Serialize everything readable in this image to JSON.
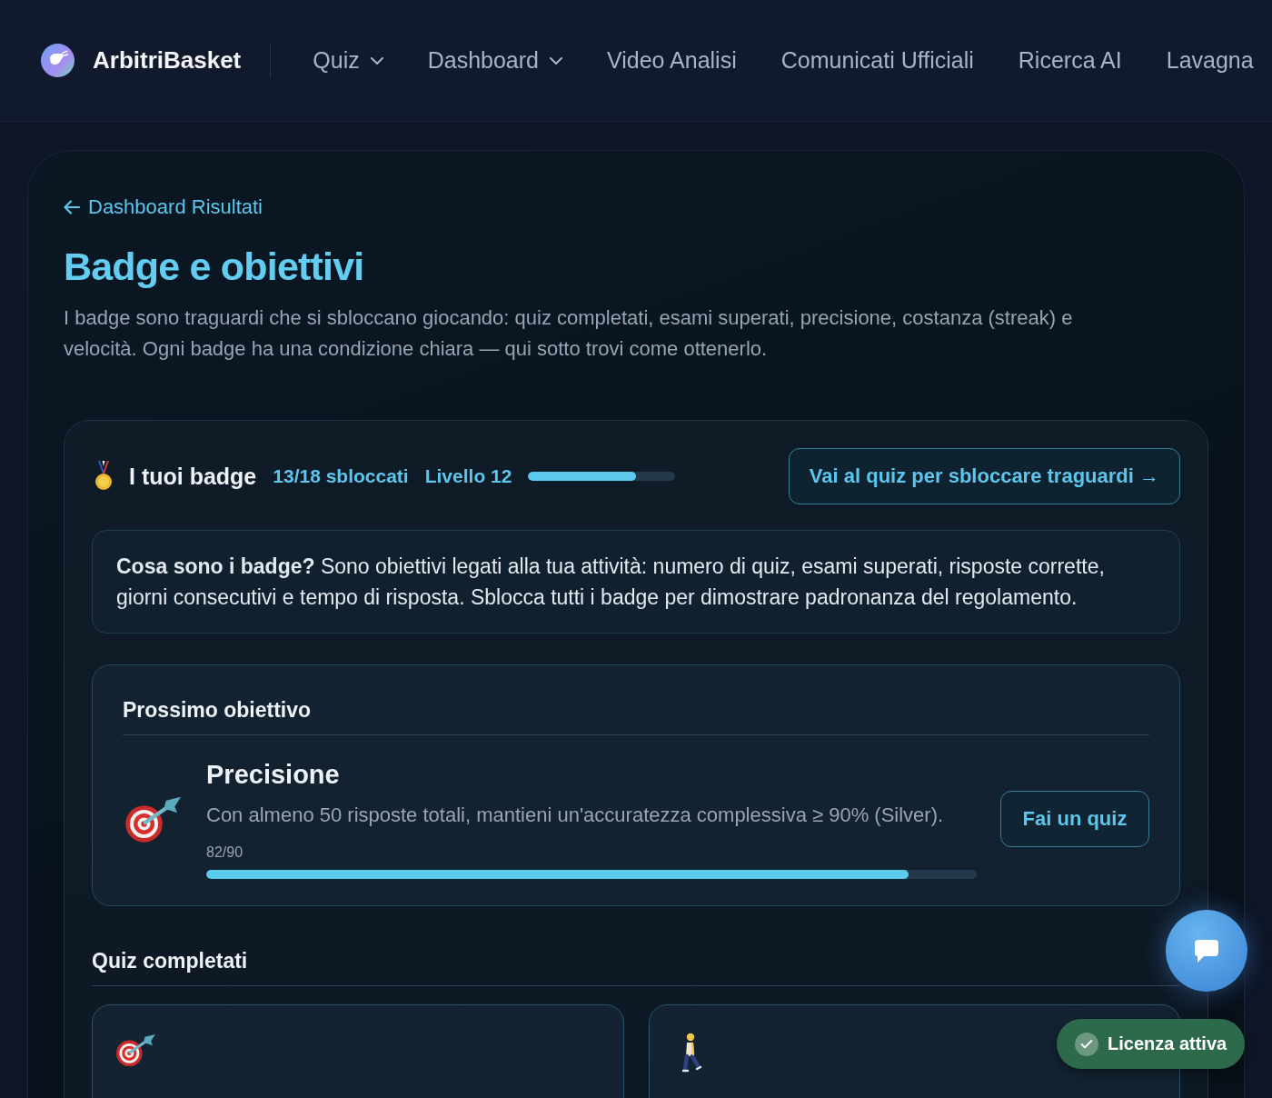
{
  "nav": {
    "brand": "ArbitriBasket",
    "items": [
      {
        "label": "Quiz",
        "has_menu": true
      },
      {
        "label": "Dashboard",
        "has_menu": true
      },
      {
        "label": "Video Analisi",
        "has_menu": false
      },
      {
        "label": "Comunicati Ufficiali",
        "has_menu": false
      },
      {
        "label": "Ricerca AI",
        "has_menu": false
      },
      {
        "label": "Lavagna",
        "has_menu": false
      }
    ]
  },
  "page": {
    "back_link": "Dashboard Risultati",
    "title": "Badge e obiettivi",
    "description": "I badge sono traguardi che si sbloccano giocando: quiz completati, esami superati, precisione, costanza (streak) e velocità. Ogni badge ha una condizione chiara — qui sotto trovi come ottenerlo."
  },
  "badges_panel": {
    "title": "I tuoi badge",
    "unlocked": "13/18 sbloccati",
    "level_label": "Livello 12",
    "level": 0.73,
    "cta": "Vai al quiz per sbloccare traguardi →"
  },
  "info": "**Cosa sono i badge?** Sono obiettivi legati alla tua attività: numero di quiz, esami superati, risposte corrette, giorni consecutivi e tempo di risposta. Sblocca tutti i badge per dimostrare padronanza del regolamento.",
  "next_goal": {
    "heading": "Prossimo obiettivo",
    "kind": "target",
    "title": "Precisione",
    "description": "Con almeno 50 risposte totali, mantieni un'accuratezza complessiva ≥ 90% (Silver).",
    "progress_text": "82/90",
    "level": 0.911,
    "button": "Fai un quiz"
  },
  "section": {
    "title": "Quiz completati",
    "cards": [
      {
        "kind": "target"
      },
      {
        "kind": "walker"
      }
    ]
  },
  "toast": {
    "label": "Licenza attiva"
  }
}
